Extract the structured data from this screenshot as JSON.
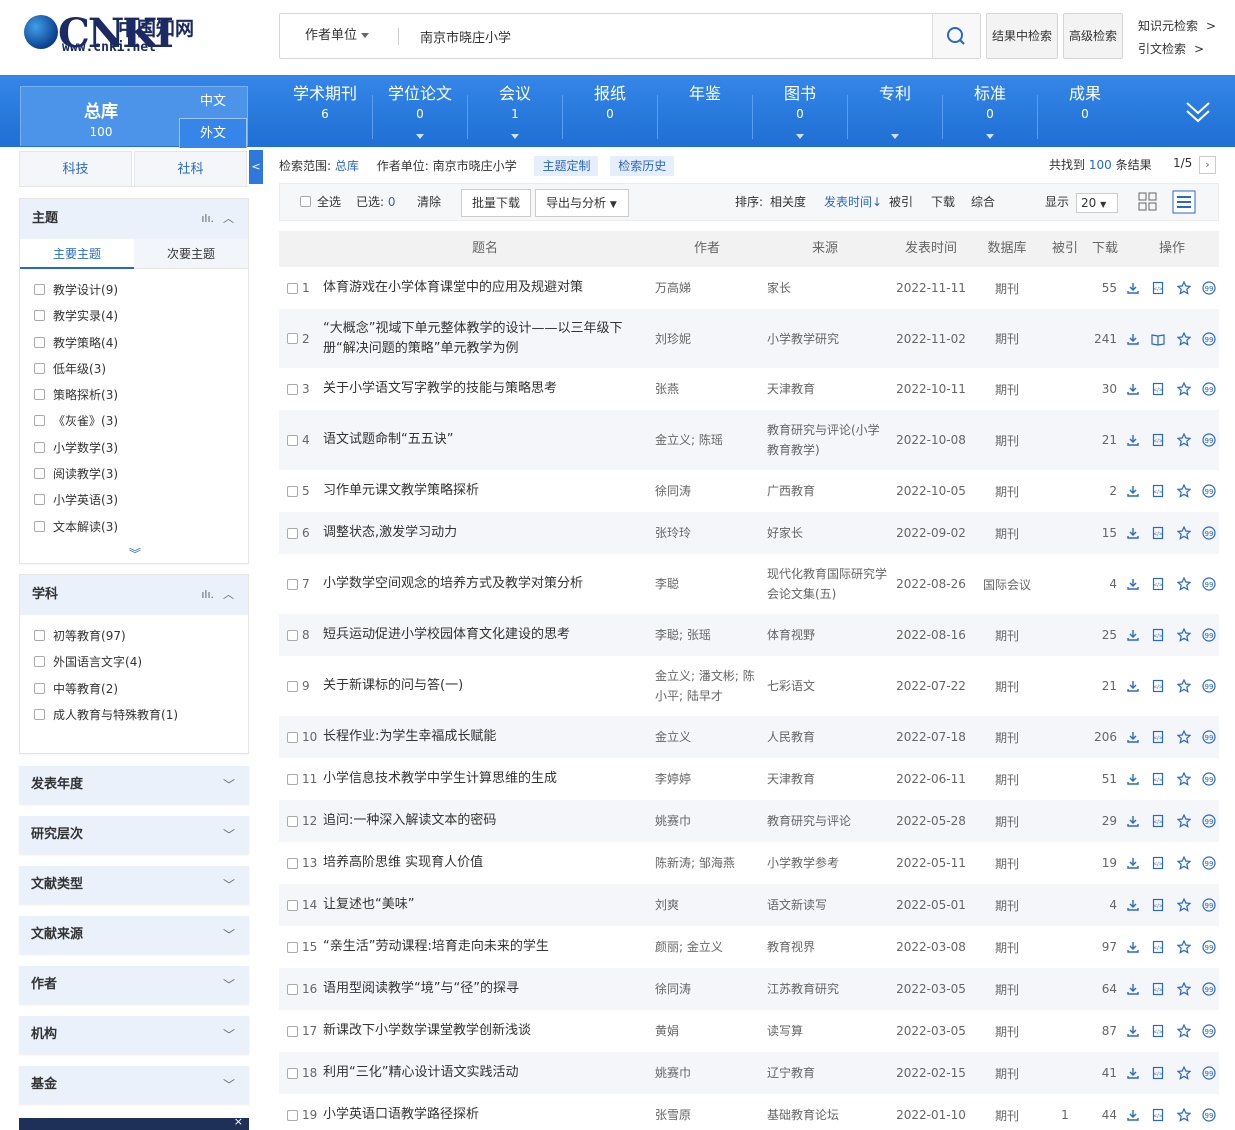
{
  "header": {
    "logo_text": "CNKI",
    "logo_cn": "中国知网",
    "logo_url": "www.cnki.net",
    "search_field": "作者单位",
    "search_value": "南京市晓庄小学",
    "btn_within": "结果中检索",
    "btn_advanced": "高级检索",
    "link_knowledge": "知识元检索",
    "link_citation": "引文检索",
    "gt": ">"
  },
  "nav": {
    "total_label": "总库",
    "total_count": "100",
    "lang_zh": "中文",
    "lang_en": "外文",
    "items": [
      {
        "label": "学术期刊",
        "count": "6"
      },
      {
        "label": "学位论文",
        "count": "0"
      },
      {
        "label": "会议",
        "count": "1"
      },
      {
        "label": "报纸",
        "count": "0"
      },
      {
        "label": "年鉴",
        "count": ""
      },
      {
        "label": "图书",
        "count": "0"
      },
      {
        "label": "专利",
        "count": ""
      },
      {
        "label": "标准",
        "count": "0"
      },
      {
        "label": "成果",
        "count": "0"
      }
    ]
  },
  "sidebar": {
    "tab_tech": "科技",
    "tab_social": "社科",
    "topic": {
      "title": "主题",
      "sub_main": "主要主题",
      "sub_secondary": "次要主题",
      "items": [
        {
          "label": "教学设计",
          "count": "(9)"
        },
        {
          "label": "教学实录",
          "count": "(4)"
        },
        {
          "label": "教学策略",
          "count": "(4)"
        },
        {
          "label": "低年级",
          "count": "(3)"
        },
        {
          "label": "策略探析",
          "count": "(3)"
        },
        {
          "label": "《灰雀》",
          "count": "(3)"
        },
        {
          "label": "小学数学",
          "count": "(3)"
        },
        {
          "label": "阅读教学",
          "count": "(3)"
        },
        {
          "label": "小学英语",
          "count": "(3)"
        },
        {
          "label": "文本解读",
          "count": "(3)"
        }
      ]
    },
    "subject": {
      "title": "学科",
      "items": [
        {
          "label": "初等教育",
          "count": "(97)"
        },
        {
          "label": "外国语言文字",
          "count": "(4)"
        },
        {
          "label": "中等教育",
          "count": "(2)"
        },
        {
          "label": "成人教育与特殊教育",
          "count": "(1)"
        }
      ]
    },
    "collapsed": [
      "发表年度",
      "研究层次",
      "文献类型",
      "文献来源",
      "作者",
      "机构",
      "基金"
    ]
  },
  "results": {
    "scope_label": "检索范围:",
    "scope_value": "总库",
    "scope_field": "作者单位:",
    "scope_field_value": "南京市晓庄小学",
    "tag_topic": "主题定制",
    "tag_history": "检索历史",
    "found_prefix": "共找到",
    "found_count": "100",
    "found_suffix": "条结果",
    "page": "1/5",
    "toolbar": {
      "select_all": "全选",
      "selected_label": "已选:",
      "selected_count": "0",
      "clear": "清除",
      "batch_download": "批量下载",
      "export": "导出与分析",
      "sort_label": "排序:",
      "sort_relevance": "相关度",
      "sort_date": "发表时间",
      "sort_cited": "被引",
      "sort_download": "下载",
      "sort_combined": "综合",
      "show_label": "显示",
      "page_size": "20"
    },
    "columns": {
      "title": "题名",
      "author": "作者",
      "source": "来源",
      "date": "发表时间",
      "db": "数据库",
      "cited": "被引",
      "downloads": "下载",
      "ops": "操作"
    },
    "rows": [
      {
        "n": "1",
        "title": "体育游戏在小学体育课堂中的应用及规避对策",
        "author": "万高娣",
        "source": "家长",
        "date": "2022-11-11",
        "db": "期刊",
        "cited": "",
        "dl": "55"
      },
      {
        "n": "2",
        "title": "“大概念”视域下单元整体教学的设计——以三年级下册“解决问题的策略”单元教学为例",
        "author": "刘珍妮",
        "source": "小学教学研究",
        "date": "2022-11-02",
        "db": "期刊",
        "cited": "",
        "dl": "241"
      },
      {
        "n": "3",
        "title": "关于小学语文写字教学的技能与策略思考",
        "author": "张燕",
        "source": "天津教育",
        "date": "2022-10-11",
        "db": "期刊",
        "cited": "",
        "dl": "30"
      },
      {
        "n": "4",
        "title": "语文试题命制“五五诀”",
        "author": "金立义; 陈瑶",
        "source": "教育研究与评论(小学教育教学)",
        "date": "2022-10-08",
        "db": "期刊",
        "cited": "",
        "dl": "21"
      },
      {
        "n": "5",
        "title": "习作单元课文教学策略探析",
        "author": "徐同涛",
        "source": "广西教育",
        "date": "2022-10-05",
        "db": "期刊",
        "cited": "",
        "dl": "2"
      },
      {
        "n": "6",
        "title": "调整状态,激发学习动力",
        "author": "张玲玲",
        "source": "好家长",
        "date": "2022-09-02",
        "db": "期刊",
        "cited": "",
        "dl": "15"
      },
      {
        "n": "7",
        "title": "小学数学空间观念的培养方式及教学对策分析",
        "author": "李聪",
        "source": "现代化教育国际研究学会论文集(五)",
        "date": "2022-08-26",
        "db": "国际会议",
        "cited": "",
        "dl": "4"
      },
      {
        "n": "8",
        "title": "短兵运动促进小学校园体育文化建设的思考",
        "author": "李聪; 张瑶",
        "source": "体育视野",
        "date": "2022-08-16",
        "db": "期刊",
        "cited": "",
        "dl": "25"
      },
      {
        "n": "9",
        "title": "关于新课标的问与答(一)",
        "author": "金立义; 潘文彬; 陈小平; 陆早才",
        "source": "七彩语文",
        "date": "2022-07-22",
        "db": "期刊",
        "cited": "",
        "dl": "21"
      },
      {
        "n": "10",
        "title": "长程作业:为学生幸福成长赋能",
        "author": "金立义",
        "source": "人民教育",
        "date": "2022-07-18",
        "db": "期刊",
        "cited": "",
        "dl": "206"
      },
      {
        "n": "11",
        "title": "小学信息技术教学中学生计算思维的生成",
        "author": "李婷婷",
        "source": "天津教育",
        "date": "2022-06-11",
        "db": "期刊",
        "cited": "",
        "dl": "51"
      },
      {
        "n": "12",
        "title": "追问:一种深入解读文本的密码",
        "author": "姚赛巾",
        "source": "教育研究与评论",
        "date": "2022-05-28",
        "db": "期刊",
        "cited": "",
        "dl": "29"
      },
      {
        "n": "13",
        "title": "培养高阶思维 实现育人价值",
        "author": "陈新涛; 邹海燕",
        "source": "小学教学参考",
        "date": "2022-05-11",
        "db": "期刊",
        "cited": "",
        "dl": "19"
      },
      {
        "n": "14",
        "title": "让复述也“美味”",
        "author": "刘爽",
        "source": "语文新读写",
        "date": "2022-05-01",
        "db": "期刊",
        "cited": "",
        "dl": "4"
      },
      {
        "n": "15",
        "title": "“亲生活”劳动课程:培育走向未来的学生",
        "author": "颜丽; 金立义",
        "source": "教育视界",
        "date": "2022-03-08",
        "db": "期刊",
        "cited": "",
        "dl": "97"
      },
      {
        "n": "16",
        "title": "语用型阅读教学“境”与“径”的探寻",
        "author": "徐同涛",
        "source": "江苏教育研究",
        "date": "2022-03-05",
        "db": "期刊",
        "cited": "",
        "dl": "64"
      },
      {
        "n": "17",
        "title": "新课改下小学数学课堂教学创新浅谈",
        "author": "黄娟",
        "source": "读写算",
        "date": "2022-03-05",
        "db": "期刊",
        "cited": "",
        "dl": "87"
      },
      {
        "n": "18",
        "title": "利用“三化”精心设计语文实践活动",
        "author": "姚赛巾",
        "source": "辽宁教育",
        "date": "2022-02-15",
        "db": "期刊",
        "cited": "",
        "dl": "41"
      },
      {
        "n": "19",
        "title": "小学英语口语教学路径探析",
        "author": "张雪原",
        "source": "基础教育论坛",
        "date": "2022-01-10",
        "db": "期刊",
        "cited": "1",
        "dl": "44"
      }
    ]
  },
  "colors": {
    "brand": "#1f6fd4",
    "link": "#2868c8",
    "accent_bg": "#eaf1fb"
  },
  "icons": {
    "search": "search-icon",
    "download": "download-icon",
    "html_read": "html-read-icon",
    "star": "star-icon",
    "quote": "quote-icon",
    "grid": "grid-view-icon",
    "list": "list-view-icon",
    "expand": "expand-down-icon",
    "collapse": "collapse-left-icon",
    "chart": "chart-icon",
    "close": "close-icon"
  }
}
